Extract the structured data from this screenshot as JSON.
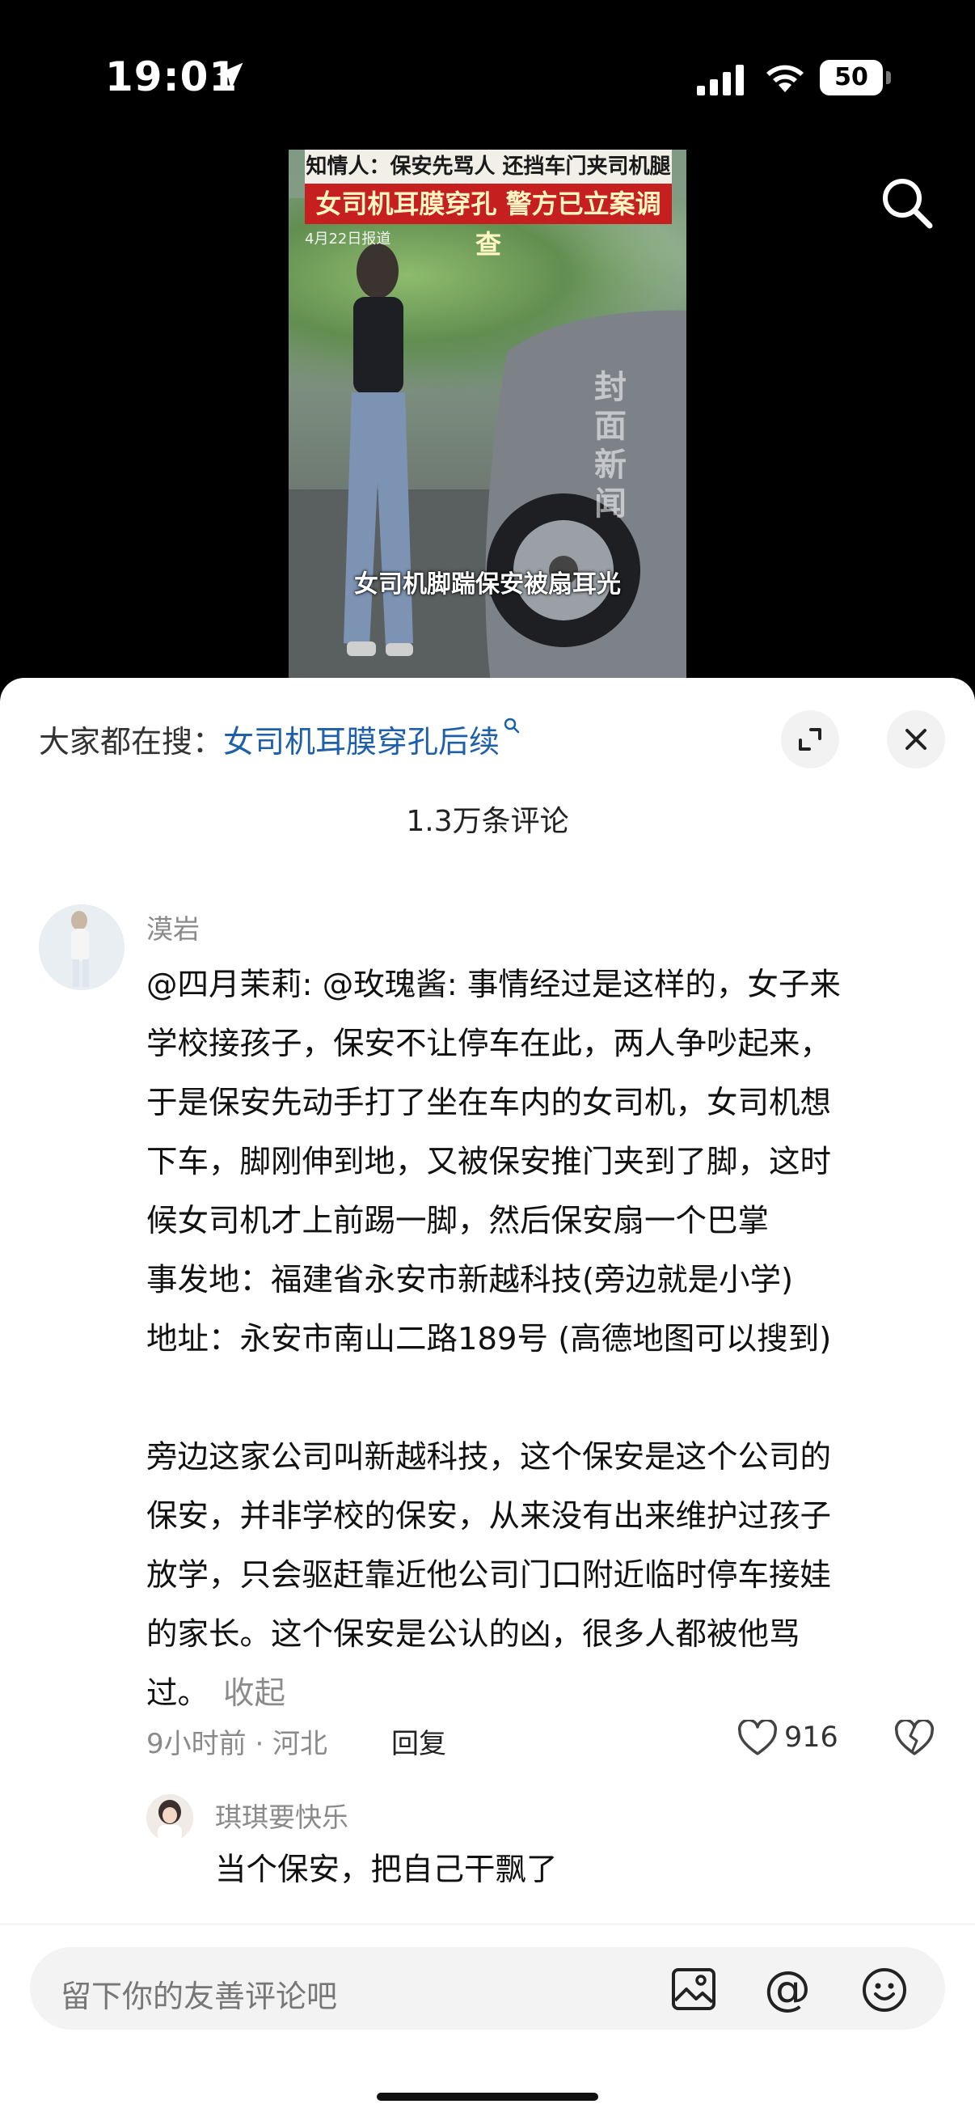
{
  "status_bar": {
    "time": "19:01",
    "battery": "50"
  },
  "video": {
    "headline_top": "知情人：保安先骂人 还挡车门夹司机腿",
    "headline_main": "女司机耳膜穿孔 警方已立案调查",
    "date": "4月22日报道",
    "watermark": "封面新闻",
    "subtitle": "女司机脚踹保安被扇耳光"
  },
  "sheet": {
    "search_prefix": "大家都在搜：",
    "search_link": "女司机耳膜穿孔后续",
    "comment_count": "1.3万条评论"
  },
  "comment": {
    "username": "漠岩",
    "lines": [
      "@四月茉莉: @玫瑰酱: 事情经过是这样的，女子来",
      "学校接孩子，保安不让停车在此，两人争吵起来，",
      "于是保安先动手打了坐在车内的女司机，女司机想",
      "下车，脚刚伸到地，又被保安推门夹到了脚，这时",
      "候女司机才上前踢一脚，然后保安扇一个巴掌",
      "事发地：福建省永安市新越科技(旁边就是小学)",
      "地址：永安市南山二路189号 (高德地图可以搜到)"
    ],
    "lines2": [
      "旁边这家公司叫新越科技，这个保安是这个公司的",
      "保安，并非学校的保安，从来没有出来维护过孩子",
      "放学，只会驱赶靠近他公司门口附近临时停车接娃",
      "的家长。这个保安是公认的凶，很多人都被他骂"
    ],
    "last_line": "过。",
    "collapse": "收起",
    "meta": "9小时前 · 河北",
    "reply": "回复",
    "likes": "916"
  },
  "reply_comment": {
    "username": "琪琪要快乐",
    "text": "当个保安，把自己干飘了"
  },
  "input": {
    "placeholder": "留下你的友善评论吧"
  }
}
